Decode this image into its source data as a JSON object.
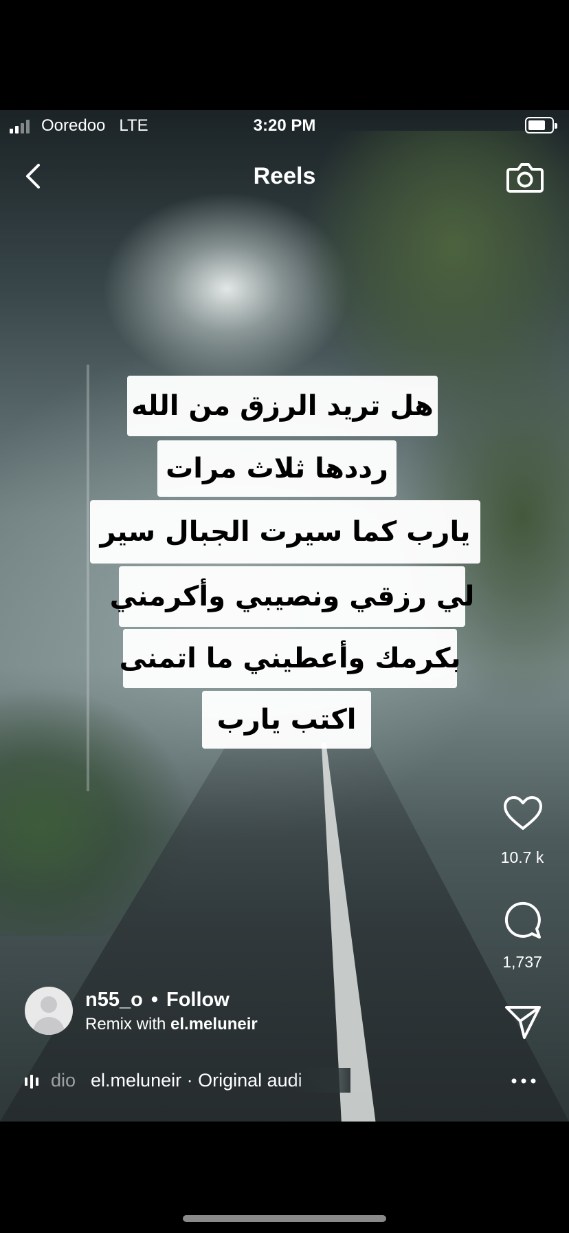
{
  "status_bar": {
    "carrier": "Ooredoo",
    "network": "LTE",
    "time": "3:20 PM"
  },
  "header": {
    "title": "Reels"
  },
  "captions": [
    "هل تريد الرزق من الله",
    "رددها ثلاث مرات",
    "يارب كما سيرت الجبال سير",
    "لي رزقي ونصيبي وأكرمني",
    "بكرمك وأعطيني ما اتمنى",
    "اكتب يارب"
  ],
  "actions": {
    "likes": "10.7 k",
    "comments": "1,737"
  },
  "post": {
    "username": "n55_o",
    "separator": "•",
    "follow_label": "Follow",
    "remix_prefix": "Remix with",
    "remix_user": "el.meluneir"
  },
  "audio": {
    "faded_text": "dio",
    "label": "el.meluneir · Original audi"
  },
  "icons": [
    "back-chevron-icon",
    "camera-icon",
    "heart-icon",
    "comment-icon",
    "share-icon",
    "more-icon",
    "audio-bars-icon"
  ]
}
